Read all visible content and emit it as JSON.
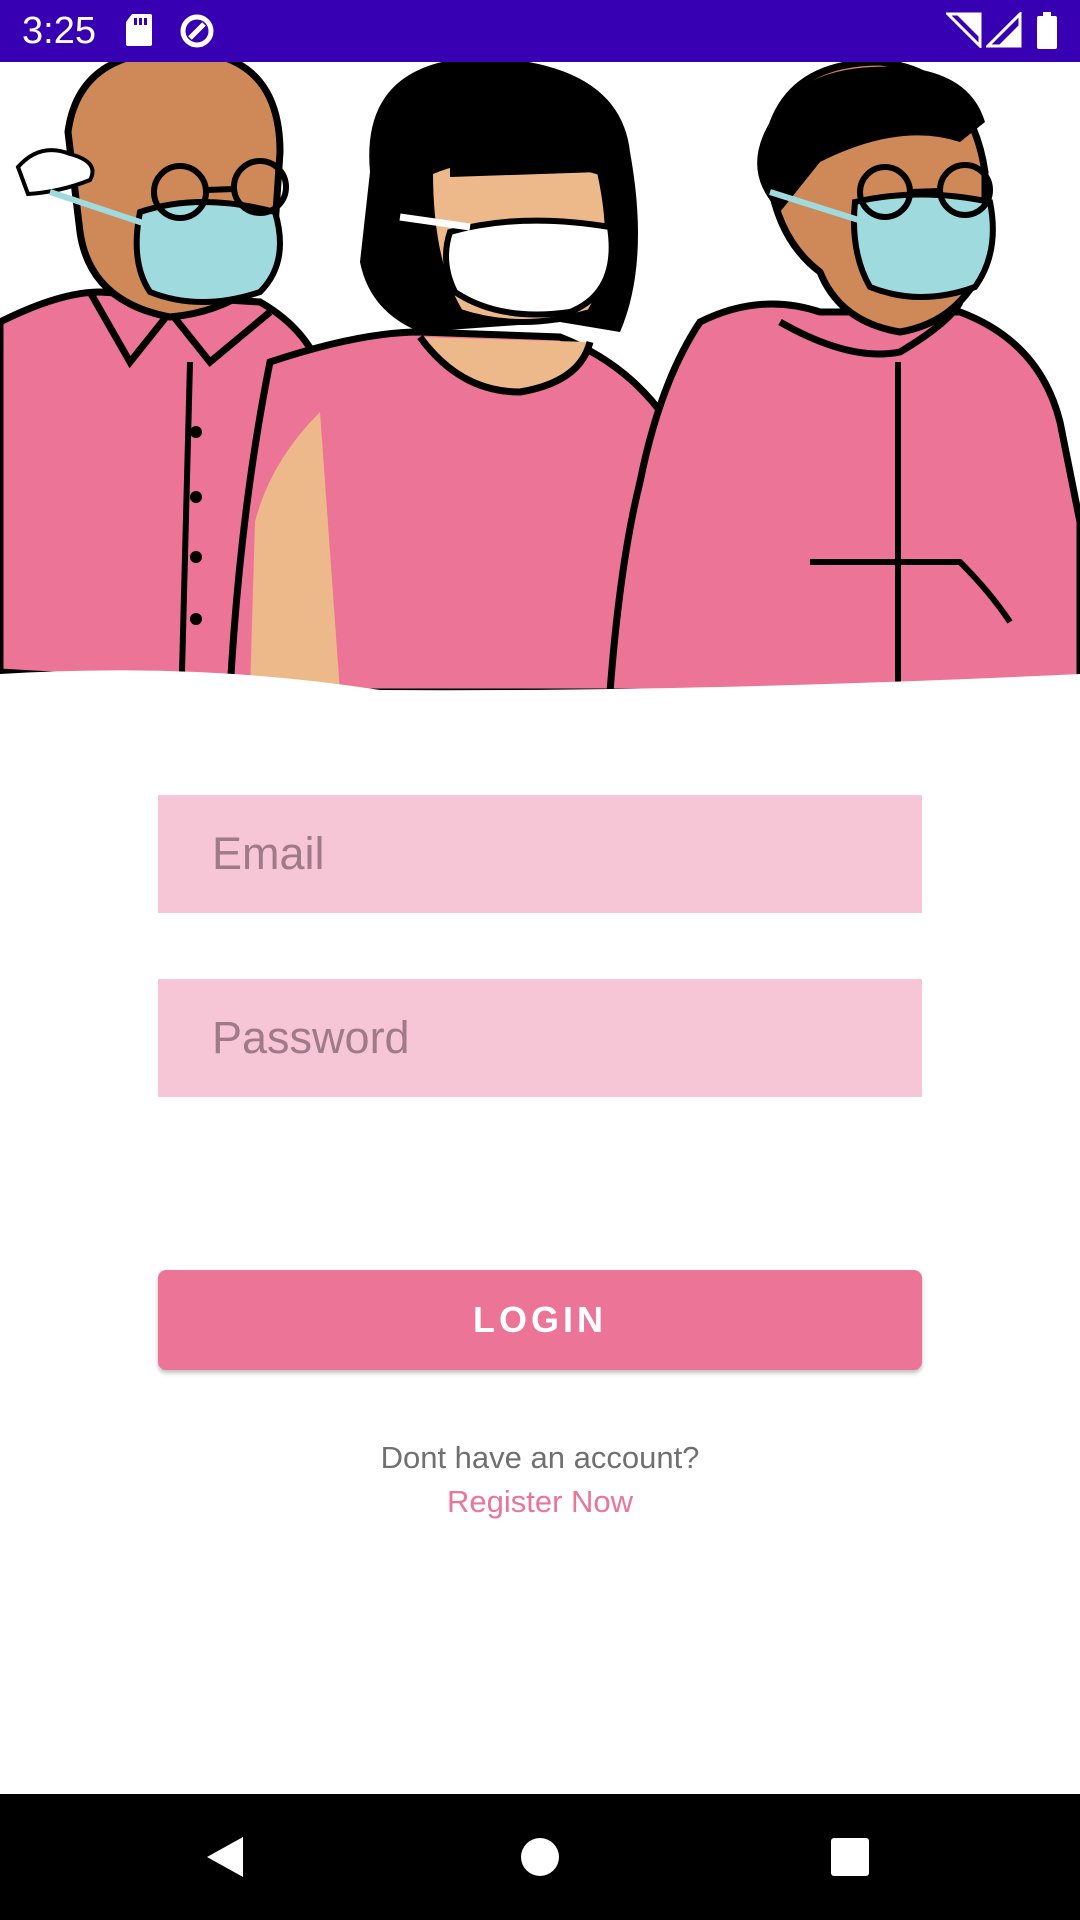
{
  "status_bar": {
    "time": "3:25",
    "left_icons": [
      "sd-card-icon",
      "data-saver-icon"
    ],
    "right_icons": [
      "wifi-icon",
      "cellular-signal-icon",
      "battery-icon"
    ],
    "color": "#3700b3"
  },
  "hero": {
    "description_icon": "people-in-masks-illustration"
  },
  "form": {
    "email_placeholder": "Email",
    "password_placeholder": "Password",
    "email_value": "",
    "password_value": "",
    "login_label": "LOGIN",
    "account_prompt": "Dont have an account?",
    "register_label": "Register Now"
  },
  "colors": {
    "accent": "#ec7597",
    "field_background": "#f7c6d6",
    "status_bar": "#3700b3"
  },
  "nav_bar": {
    "icons": [
      "back-icon",
      "home-icon",
      "recents-icon"
    ]
  }
}
